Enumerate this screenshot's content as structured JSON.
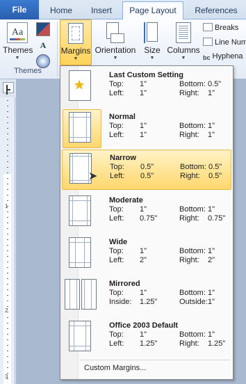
{
  "tabs": [
    {
      "label": "File"
    },
    {
      "label": "Home"
    },
    {
      "label": "Insert"
    },
    {
      "label": "Page Layout"
    },
    {
      "label": "References"
    }
  ],
  "ribbon": {
    "themes_label": "Themes",
    "themes_icon_text": "Aa",
    "group_themes": "Themes",
    "fonts_icon_text": "A",
    "margins_label": "Margins",
    "orientation_label": "Orientation",
    "size_label": "Size",
    "columns_label": "Columns",
    "breaks_label": "Breaks",
    "line_numbers_label": "Line Num",
    "hyphenation_label": "Hyphena",
    "hyphenation_icon_text": "bc"
  },
  "ruler": {
    "numbers": [
      "1",
      "2",
      "3"
    ]
  },
  "margins_menu": {
    "items": [
      {
        "title": "Last Custom Setting",
        "top_key": "Top:",
        "top": "1\"",
        "bottom_key": "Bottom:",
        "bottom": "0.5\"",
        "left_key": "Left:",
        "left": "1\"",
        "right_key": "Right:",
        "right": "1\""
      },
      {
        "title": "Normal",
        "top_key": "Top:",
        "top": "1\"",
        "bottom_key": "Bottom:",
        "bottom": "1\"",
        "left_key": "Left:",
        "left": "1\"",
        "right_key": "Right:",
        "right": "1\""
      },
      {
        "title": "Narrow",
        "top_key": "Top:",
        "top": "0.5\"",
        "bottom_key": "Bottom:",
        "bottom": "0.5\"",
        "left_key": "Left:",
        "left": "0.5\"",
        "right_key": "Right:",
        "right": "0.5\""
      },
      {
        "title": "Moderate",
        "top_key": "Top:",
        "top": "1\"",
        "bottom_key": "Bottom:",
        "bottom": "1\"",
        "left_key": "Left:",
        "left": "0.75\"",
        "right_key": "Right:",
        "right": "0.75\""
      },
      {
        "title": "Wide",
        "top_key": "Top:",
        "top": "1\"",
        "bottom_key": "Bottom:",
        "bottom": "1\"",
        "left_key": "Left:",
        "left": "2\"",
        "right_key": "Right:",
        "right": "2\""
      },
      {
        "title": "Mirrored",
        "top_key": "Top:",
        "top": "1\"",
        "bottom_key": "Bottom:",
        "bottom": "1\"",
        "left_key": "Inside:",
        "left": "1.25\"",
        "right_key": "Outside:",
        "right": "1\""
      },
      {
        "title": "Office 2003 Default",
        "top_key": "Top:",
        "top": "1\"",
        "bottom_key": "Bottom:",
        "bottom": "1\"",
        "left_key": "Left:",
        "left": "1.25\"",
        "right_key": "Right:",
        "right": "1.25\""
      }
    ],
    "custom_label": "Custom Margins..."
  }
}
